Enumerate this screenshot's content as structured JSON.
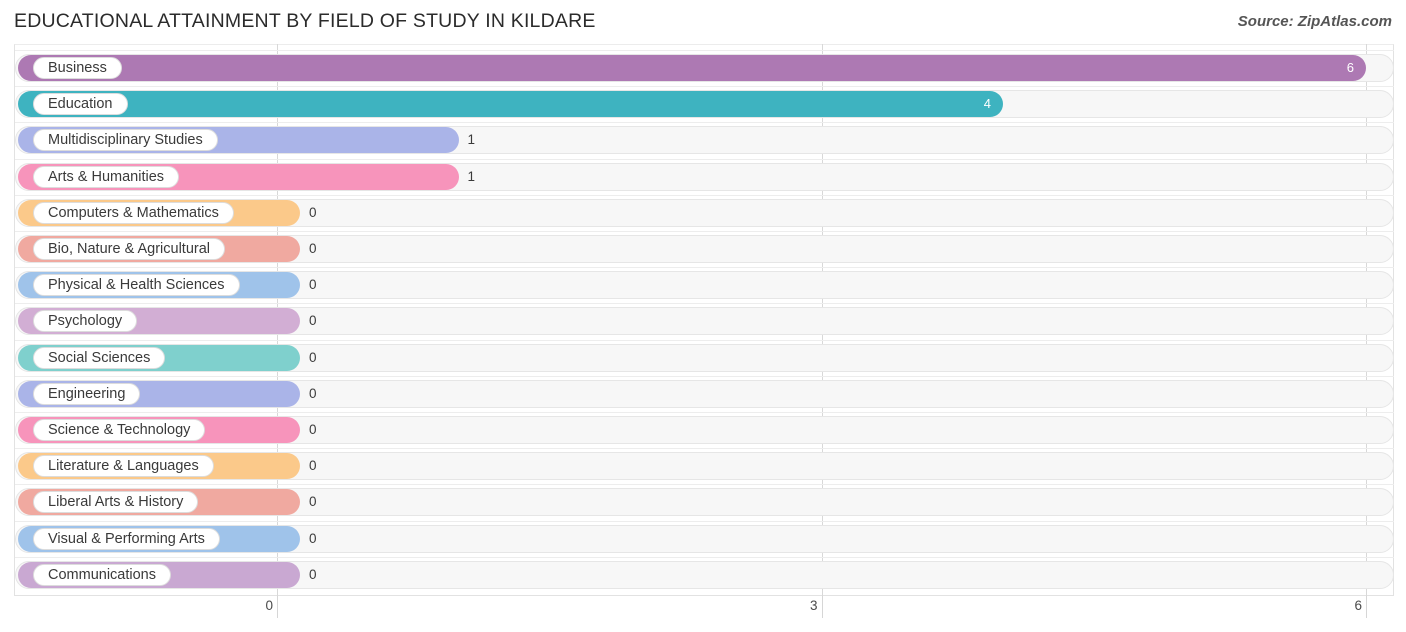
{
  "header": {
    "title": "EDUCATIONAL ATTAINMENT BY FIELD OF STUDY IN KILDARE",
    "source": "Source: ZipAtlas.com"
  },
  "chart_data": {
    "type": "bar",
    "orientation": "horizontal",
    "title": "EDUCATIONAL ATTAINMENT BY FIELD OF STUDY IN KILDARE",
    "xlabel": "",
    "ylabel": "",
    "xlim": [
      0,
      6
    ],
    "ticks": [
      "0",
      "3",
      "6"
    ],
    "tick_values": [
      0,
      3,
      6
    ],
    "grid": true,
    "legend": "none",
    "categories": [
      "Business",
      "Education",
      "Multidisciplinary Studies",
      "Arts & Humanities",
      "Computers & Mathematics",
      "Bio, Nature & Agricultural",
      "Physical & Health Sciences",
      "Psychology",
      "Social Sciences",
      "Engineering",
      "Science & Technology",
      "Literature & Languages",
      "Liberal Arts & History",
      "Visual & Performing Arts",
      "Communications"
    ],
    "values": [
      6,
      4,
      1,
      1,
      0,
      0,
      0,
      0,
      0,
      0,
      0,
      0,
      0,
      0,
      0
    ],
    "value_labels": [
      "6",
      "4",
      "1",
      "1",
      "0",
      "0",
      "0",
      "0",
      "0",
      "0",
      "0",
      "0",
      "0",
      "0",
      "0"
    ],
    "colors": [
      "#ad79b3",
      "#3eb3c0",
      "#aab4e8",
      "#f794bb",
      "#fbc98a",
      "#f0a9a0",
      "#9fc3ea",
      "#d2aed4",
      "#7fd0cd",
      "#aab4e8",
      "#f794bb",
      "#fbc98a",
      "#f0a9a0",
      "#9fc3ea",
      "#c9a8d2"
    ]
  }
}
